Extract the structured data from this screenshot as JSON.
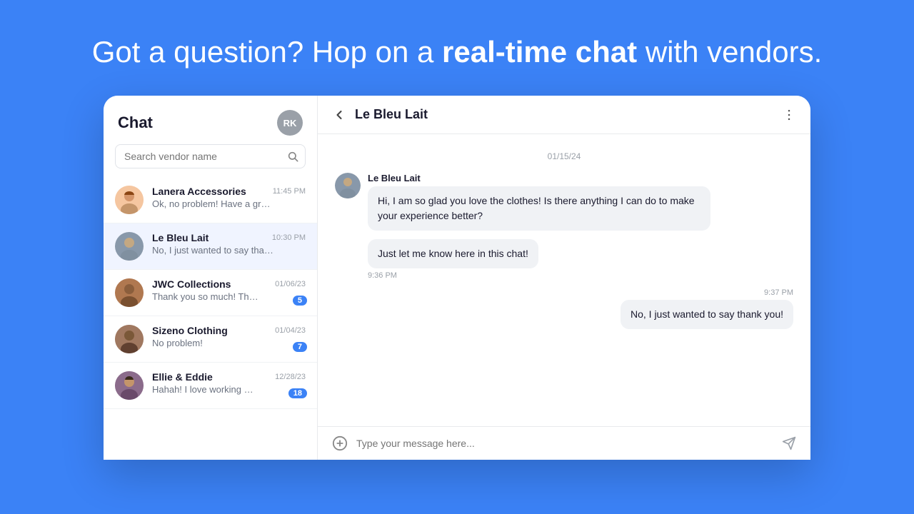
{
  "hero": {
    "title_start": "Got a question? Hop on a ",
    "title_bold": "real-time chat",
    "title_end": " with vendors."
  },
  "chat_panel": {
    "title": "Chat",
    "user_initials": "RK",
    "search_placeholder": "Search vendor name"
  },
  "chat_list": [
    {
      "id": "lanera",
      "name": "Lanera Accessories",
      "preview": "Ok, no problem! Have a great day!",
      "time": "11:45 PM",
      "badge": null
    },
    {
      "id": "lebleu",
      "name": "Le Bleu Lait",
      "preview": "No, I just wanted to say thank you!",
      "time": "10:30 PM",
      "badge": null,
      "active": true
    },
    {
      "id": "jwc",
      "name": "JWC Collections",
      "preview": "Thank you so much! That was very helpful!",
      "time": "01/06/23",
      "badge": 5
    },
    {
      "id": "sizeno",
      "name": "Sizeno Clothing",
      "preview": "No problem!",
      "time": "01/04/23",
      "badge": 7
    },
    {
      "id": "ellie",
      "name": "Ellie & Eddie",
      "preview": "Hahah! I love working with you Sasha!",
      "time": "12/28/23",
      "badge": 18
    }
  ],
  "active_chat": {
    "vendor_name": "Le Bleu Lait",
    "date_divider": "01/15/24",
    "messages": [
      {
        "sender": "Le Bleu Lait",
        "side": "left",
        "lines": [
          "Hi, I am so glad you love the clothes! Is there anything",
          "I can do to make your experience better?"
        ],
        "time": null
      },
      {
        "sender": "Le Bleu Lait",
        "side": "left",
        "lines": [
          "Just let me know here in this chat!"
        ],
        "time": "9:36 PM"
      },
      {
        "sender": "me",
        "side": "right",
        "lines": [
          "No, I just wanted to say thank you!"
        ],
        "time": "9:37 PM"
      }
    ],
    "input_placeholder": "Type your message here..."
  },
  "labels": {
    "back": "←",
    "more": "⋮",
    "attach": "+",
    "send": "➤"
  }
}
